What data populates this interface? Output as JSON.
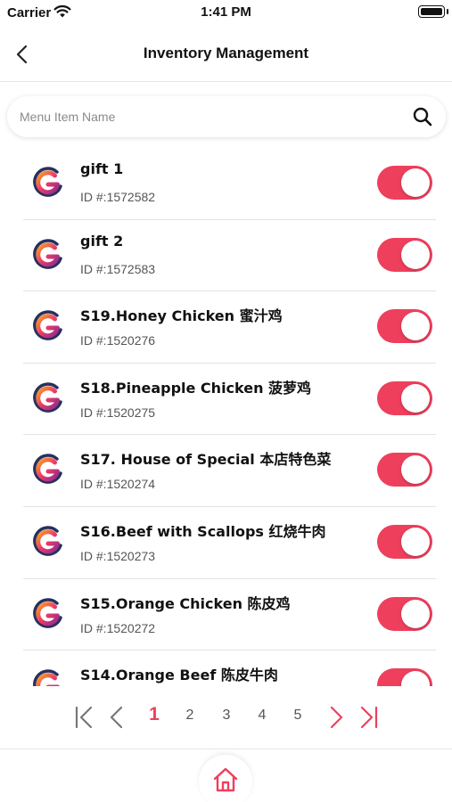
{
  "status_bar": {
    "carrier": "Carrier",
    "time": "1:41 PM"
  },
  "header": {
    "title": "Inventory Management",
    "back_icon": "chevron-left-icon"
  },
  "search": {
    "placeholder": "Menu Item Name",
    "value": "",
    "icon": "search-icon"
  },
  "items": [
    {
      "name": "gift 1",
      "id": "ID #:1572582",
      "enabled": true
    },
    {
      "name": "gift 2",
      "id": "ID #:1572583",
      "enabled": true
    },
    {
      "name": "S19.Honey Chicken 蜜汁鸡",
      "id": "ID #:1520276",
      "enabled": true
    },
    {
      "name": "S18.Pineapple Chicken 菠萝鸡",
      "id": "ID #:1520275",
      "enabled": true
    },
    {
      "name": "S17. House of Special 本店特色菜",
      "id": "ID #:1520274",
      "enabled": true
    },
    {
      "name": "S16.Beef with Scallops 红烧牛肉",
      "id": "ID #:1520273",
      "enabled": true
    },
    {
      "name": "S15.Orange Chicken 陈皮鸡",
      "id": "ID #:1520272",
      "enabled": true
    },
    {
      "name": "S14.Orange Beef 陈皮牛肉",
      "id": "",
      "enabled": true
    }
  ],
  "pagination": {
    "pages": [
      "1",
      "2",
      "3",
      "4",
      "5"
    ],
    "current": "1"
  },
  "bottom_nav": {
    "home_icon": "home-icon"
  },
  "colors": {
    "accent": "#ee3f5c",
    "divider": "#e3e3e3"
  }
}
